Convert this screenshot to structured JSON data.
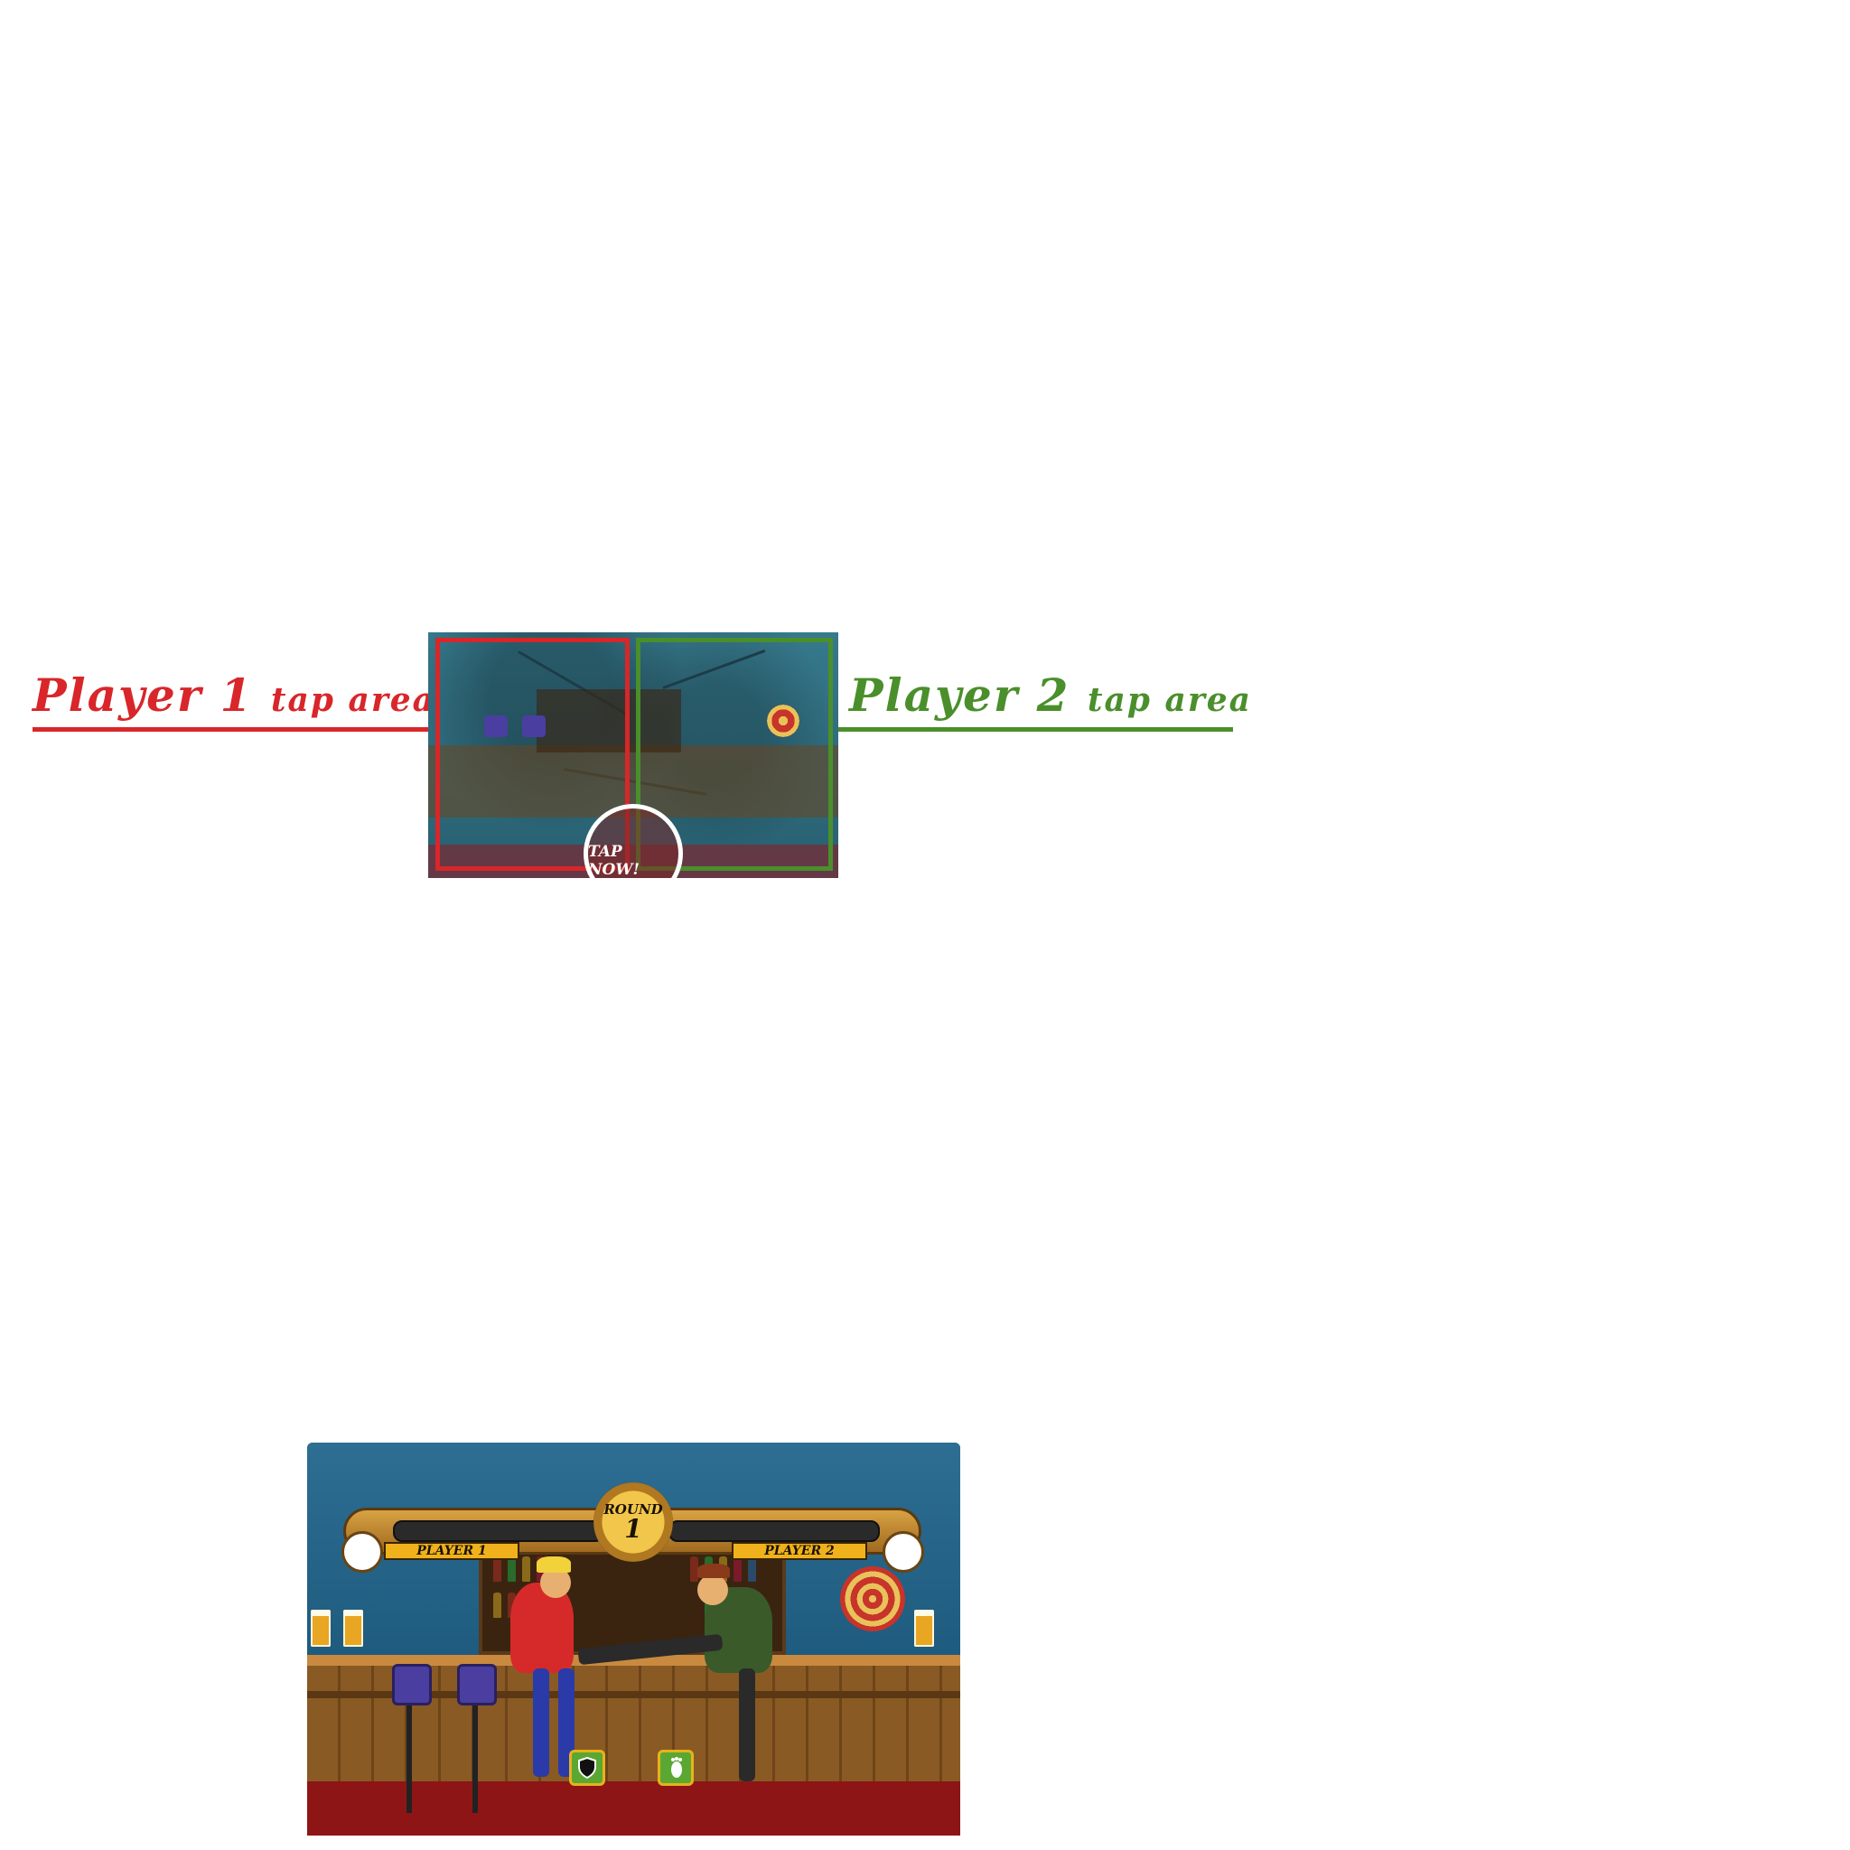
{
  "tutorial": {
    "player1_label_main": "Player 1",
    "player1_label_small": "tap area",
    "player2_label_main": "Player 2",
    "player2_label_small": "tap area",
    "tap_now": "TAP NOW!",
    "player1_color": "#d8262a",
    "player2_color": "#4a8f2b"
  },
  "game": {
    "round_word": "ROUND",
    "round_number": "1",
    "player1_name": "PLAYER 1",
    "player2_name": "PLAYER 2",
    "buttons": [
      {
        "icon": "shield-icon"
      },
      {
        "icon": "foot-icon"
      }
    ]
  }
}
